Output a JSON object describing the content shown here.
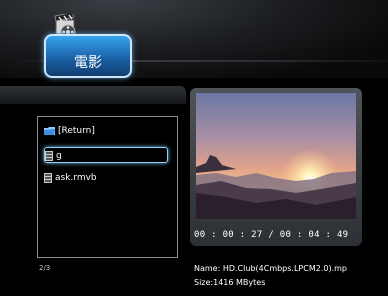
{
  "header": {
    "tab_label": "電影",
    "tab_icon": "film-clapper-icon"
  },
  "browser": {
    "items": [
      {
        "label": "[Return]",
        "icon": "folder-return-icon"
      },
      {
        "label": "g",
        "icon": "video-file-icon",
        "selected": true
      },
      {
        "label": "ask.rmvb",
        "icon": "video-file-icon"
      }
    ],
    "pager": "2/3"
  },
  "preview": {
    "timecode": "00 : 00 : 27 / 00 : 04 : 49",
    "name_line": "Name: HD.Club(4Cmbps.LPCM2.0).mp",
    "size_line": "Size:1416 MBytes"
  },
  "colors": {
    "accent": "#2a8ee0",
    "highlight": "#8fd0ff",
    "background": "#000000"
  }
}
